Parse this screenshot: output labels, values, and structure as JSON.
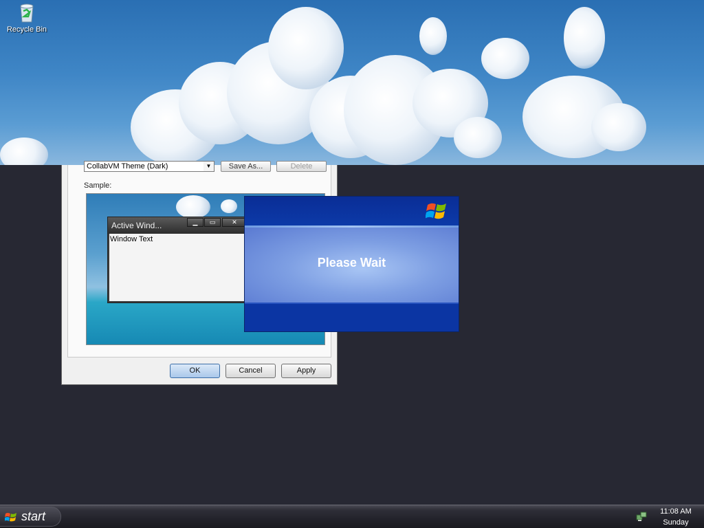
{
  "desktop": {
    "icons": [
      {
        "label": "Recycle Bin",
        "icon": "recycle-bin-icon"
      }
    ]
  },
  "display_dialog": {
    "theme_select": {
      "value": "CollabVM Theme (Dark)"
    },
    "save_as_label": "Save As...",
    "delete_label": "Delete",
    "sample_label": "Sample:",
    "preview": {
      "active_window_title": "Active Wind...",
      "window_text": "Window Text"
    },
    "buttons": {
      "ok": "OK",
      "cancel": "Cancel",
      "apply": "Apply"
    }
  },
  "please_wait": {
    "message": "Please Wait",
    "logo": "windows-xp-logo"
  },
  "taskbar": {
    "start_label": "start",
    "tray_icon": "network-icon",
    "clock_time": "11:08 AM",
    "clock_day": "Sunday"
  },
  "colors": {
    "desktop_bg": "#272833",
    "wait_blue": "#0a3aa5",
    "taskbar": "#23232b"
  }
}
